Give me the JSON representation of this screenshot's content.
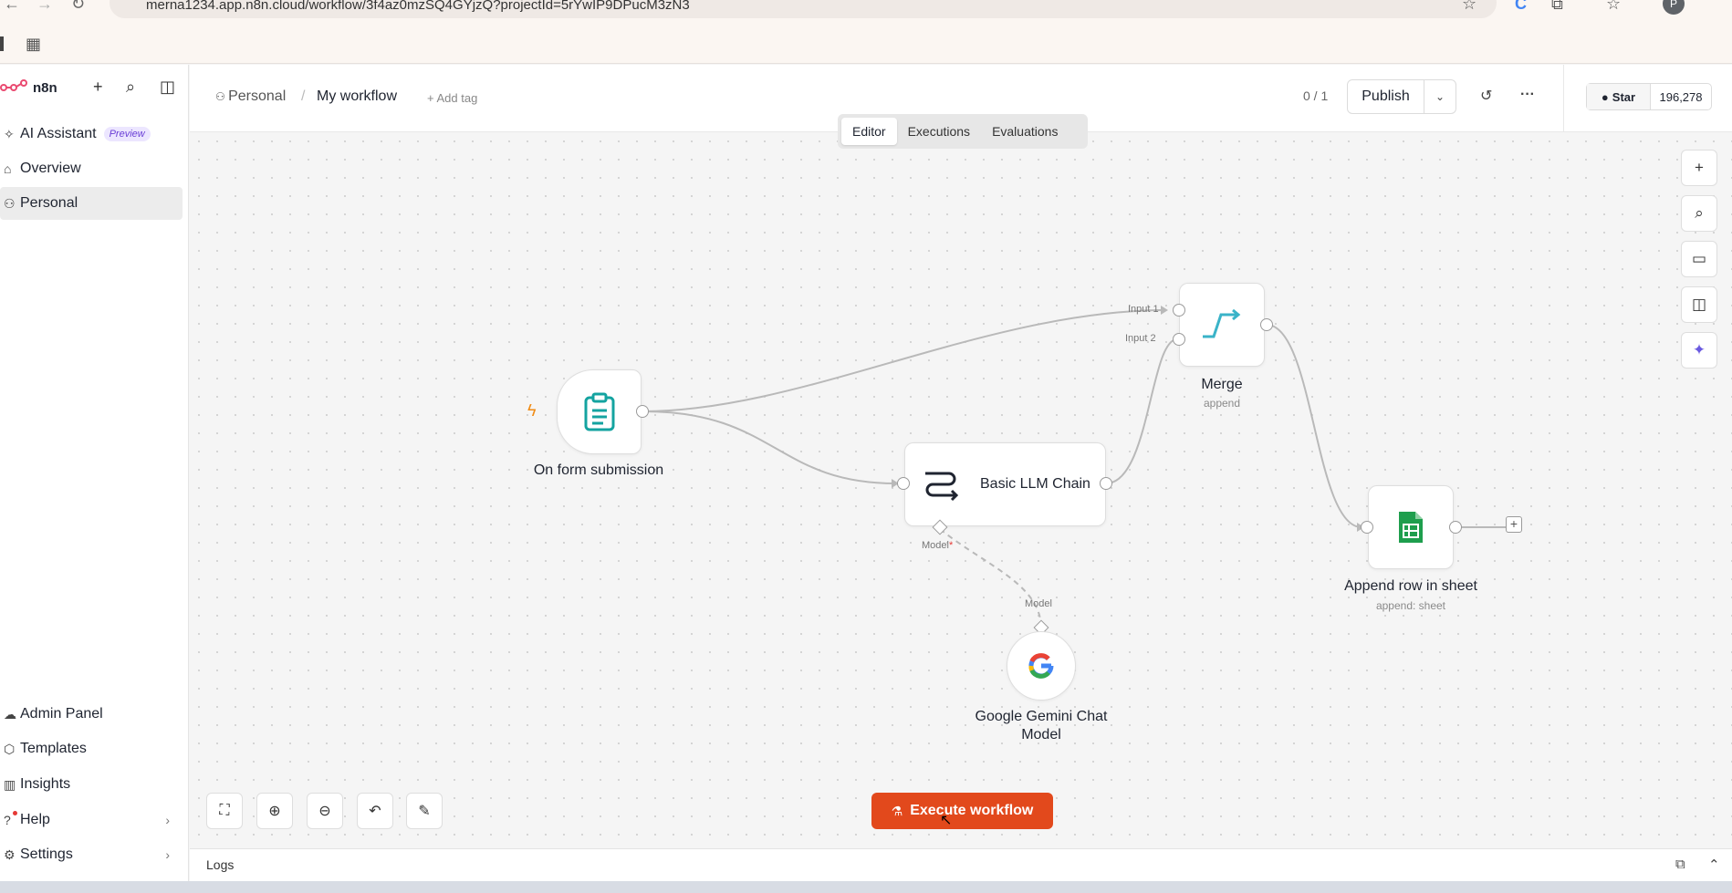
{
  "browser": {
    "url": "merna1234.app.n8n.cloud/workflow/3f4az0mzSQ4GYjzQ?projectId=5rYwIP9DPucM3zN3"
  },
  "sidebar": {
    "brand": "n8n",
    "top_items": [
      {
        "label": "AI Assistant",
        "badge": "Preview"
      },
      {
        "label": "Overview"
      },
      {
        "label": "Personal"
      }
    ],
    "bottom_items": [
      {
        "label": "Admin Panel"
      },
      {
        "label": "Templates"
      },
      {
        "label": "Insights"
      },
      {
        "label": "Help"
      },
      {
        "label": "Settings"
      }
    ]
  },
  "header": {
    "project": "Personal",
    "workflow_name": "My workflow",
    "add_tag": "+ Add tag",
    "counter": "0 / 1",
    "publish_label": "Publish",
    "github_star": "Star",
    "github_count": "196,278"
  },
  "tabs": [
    "Editor",
    "Executions",
    "Evaluations"
  ],
  "nodes": {
    "form_trigger": {
      "label": "On form submission"
    },
    "merge": {
      "label": "Merge",
      "sub": "append",
      "input1": "Input 1",
      "input2": "Input 2"
    },
    "llm_chain": {
      "label": "Basic LLM Chain",
      "model_port": "Model"
    },
    "gemini": {
      "label_line1": "Google Gemini Chat",
      "label_line2": "Model",
      "model_port": "Model"
    },
    "sheets": {
      "label": "Append row in sheet",
      "sub": "append: sheet"
    }
  },
  "execute_label": "Execute workflow",
  "logs_label": "Logs",
  "colors": {
    "execute": "#e2491c",
    "trigger_icon": "#14a3a0",
    "merge_icon": "#3ab3c8",
    "sheets_green": "#1e9e4d",
    "preview_badge": "#6a3fd6"
  }
}
